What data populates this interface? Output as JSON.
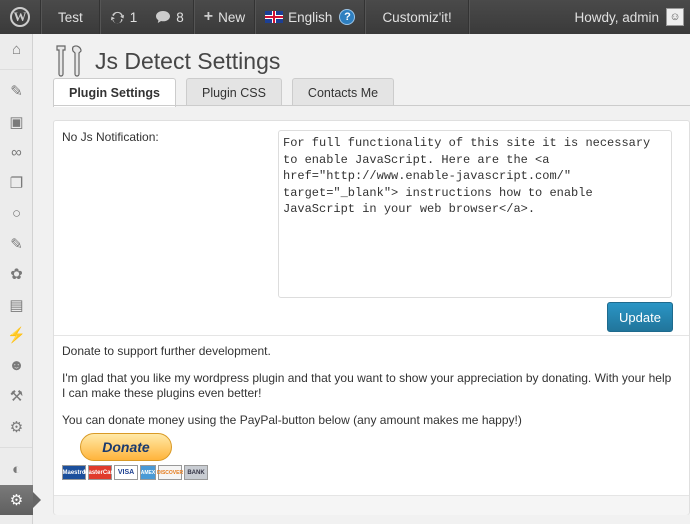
{
  "adminbar": {
    "site_name": "Test",
    "updates_count": "1",
    "comments_count": "8",
    "new_label": "New",
    "language_label": "English",
    "help_glyph": "?",
    "customize_label": "Customiz'it!",
    "howdy_label": "Howdy, admin"
  },
  "sidebar": {
    "icons": [
      "dashboard-icon",
      "posts-icon",
      "media-icon",
      "links-icon",
      "pages-icon",
      "comments-icon",
      "pin-icon",
      "appearance-icon",
      "widgets-icon",
      "plugins-icon",
      "users-icon",
      "tools-icon",
      "settings-tools-icon",
      "collapse-icon",
      "settings-icon",
      "play-icon"
    ],
    "active_index": 14
  },
  "page": {
    "title": "Js Detect Settings",
    "tabs": [
      {
        "label": "Plugin Settings",
        "active": true
      },
      {
        "label": "Plugin CSS",
        "active": false
      },
      {
        "label": "Contacts Me",
        "active": false
      }
    ]
  },
  "form": {
    "field_label": "No Js Notification:",
    "textarea_value": "For full functionality of this site it is necessary to enable JavaScript. Here are the <a href=\"http://www.enable-javascript.com/\" target=\"_blank\"> instructions how to enable JavaScript in your web browser</a>.",
    "update_label": "Update"
  },
  "donate": {
    "line1": "Donate to support further development.",
    "line2": "I'm glad that you like my wordpress plugin and that you want to show your appreciation by donating. With your help I can make these plugins even better!",
    "line3": "You can donate money using the PayPal-button below (any amount makes me happy!)",
    "paypal_label": "Donate",
    "cards": [
      "Maestro",
      "MasterCard",
      "VISA",
      "AMEX",
      "DISCOVER",
      "BANK"
    ]
  },
  "colors": {
    "adminbar_bg": "#464646",
    "primary_button": "#21759b",
    "sidebar_active": "#6d6d6d"
  }
}
